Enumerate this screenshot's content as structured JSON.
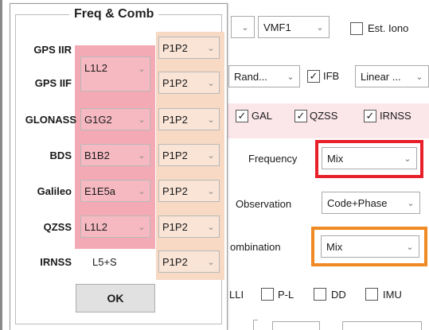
{
  "dialog": {
    "title": "Freq & Comb",
    "rows": [
      {
        "system": "GPS IIR",
        "freq": "",
        "comb": "P1P2"
      },
      {
        "system": "GPS IIF",
        "freq": "",
        "comb": "P1P2"
      },
      {
        "system": "GLONASS",
        "freq": "G1G2",
        "comb": "P1P2"
      },
      {
        "system": "BDS",
        "freq": "B1B2",
        "comb": "P1P2"
      },
      {
        "system": "Galileo",
        "freq": "E1E5a",
        "comb": "P1P2"
      },
      {
        "system": "QZSS",
        "freq": "L1L2",
        "comb": "P1P2"
      },
      {
        "system": "IRNSS",
        "freq": "L5+S",
        "comb": "P1P2"
      }
    ],
    "gps_shared_freq": "L1L2",
    "ok_label": "OK",
    "freq_highlight_color": "#f4aab4",
    "comb_highlight_color": "#f7d9c4"
  },
  "background": {
    "row1": {
      "combo1": "",
      "combo2": "VMF1",
      "est_iono_label": "Est. Iono"
    },
    "row2": {
      "combo1": "Rand...",
      "ifb_label": "IFB",
      "combo2": "Linear ..."
    },
    "row3": {
      "gal": "GAL",
      "qzss": "QZSS",
      "irnss": "IRNSS"
    },
    "frequency": {
      "label": "Frequency",
      "value": "Mix",
      "highlight_color": "#e8202a"
    },
    "observation": {
      "label": "Observation",
      "value": "Code+Phase"
    },
    "combination": {
      "label": "ombination",
      "value": "Mix",
      "highlight_color": "#f08a24"
    },
    "row_bottom": {
      "lli": "LLI",
      "pl": "P-L",
      "dd": "DD",
      "imu": "IMU"
    }
  }
}
